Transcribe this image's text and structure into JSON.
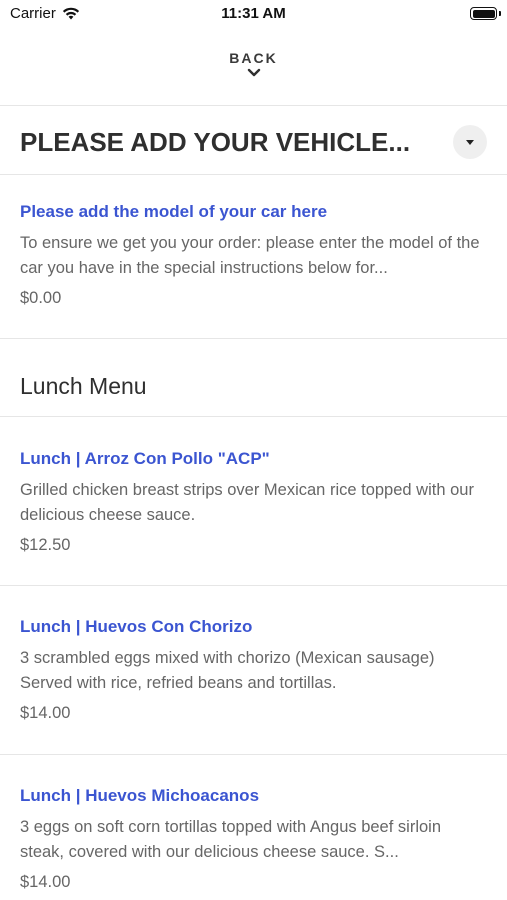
{
  "status": {
    "carrier": "Carrier",
    "time": "11:31 AM"
  },
  "nav": {
    "back_label": "BACK"
  },
  "section": {
    "title": "PLEASE ADD YOUR VEHICLE..."
  },
  "vehicle_item": {
    "title": "Please add the model of your car here",
    "description": "To ensure we get you your order: please enter the model of the car you have in the special instructions below for...",
    "price": "$0.00"
  },
  "lunch_menu": {
    "heading": "Lunch Menu",
    "items": [
      {
        "title": "Lunch | Arroz Con Pollo \"ACP\"",
        "description": "Grilled chicken breast strips over Mexican rice topped with our delicious cheese sauce.",
        "price": "$12.50"
      },
      {
        "title": "Lunch | Huevos Con Chorizo",
        "description": "3 scrambled eggs mixed with chorizo (Mexican sausage) Served with rice, refried beans and tortillas.",
        "price": "$14.00"
      },
      {
        "title": "Lunch | Huevos Michoacanos",
        "description": "3 eggs on soft corn tortillas topped with Angus beef sirloin steak, covered with our delicious cheese sauce. S...",
        "price": "$14.00"
      }
    ]
  },
  "icons": {
    "wifi": "wifi-icon",
    "battery": "battery-icon",
    "back_chevron": "chevron-down-icon",
    "dropdown": "caret-down-icon"
  }
}
